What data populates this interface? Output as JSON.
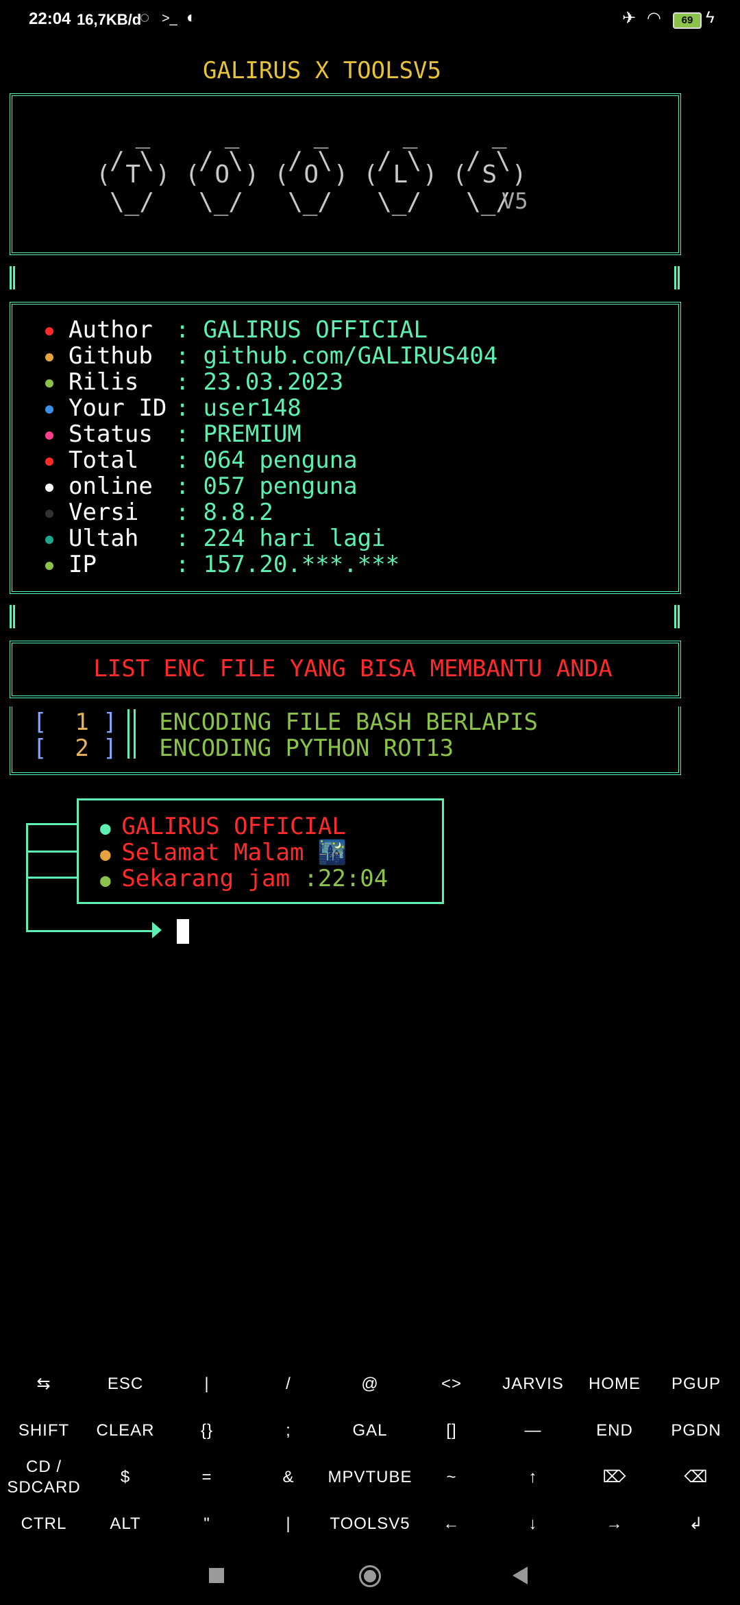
{
  "status_bar": {
    "time": "22:04",
    "speed": "16,7KB/d",
    "battery": "69",
    "icons": [
      "whatsapp-icon",
      "terminal-icon",
      "compass-icon",
      "airplane-icon",
      "wifi-icon",
      "battery-icon",
      "charging-icon"
    ]
  },
  "terminal": {
    "title": "GALIRUS X TOOLSV5",
    "logo_lines": [
      " _     _     _     _     _",
      "/ \\   / \\   / \\   / \\   / \\",
      "( T ) ( O ) ( O ) ( L ) ( S )",
      "\\_/   \\_/   \\_/   \\_/   \\_/"
    ],
    "logo_version": "V5",
    "info_separator": ":",
    "info": [
      {
        "label": "Author",
        "value": "GALIRUS OFFICIAL",
        "dot_color": "#ff2a2a"
      },
      {
        "label": "Github",
        "value": "github.com/GALIRUS404",
        "dot_color": "#e6a23c"
      },
      {
        "label": "Rilis",
        "value": "23.03.2023",
        "dot_color": "#8bc34a"
      },
      {
        "label": "Your ID",
        "value": "user148",
        "dot_color": "#3b8fe6"
      },
      {
        "label": "Status",
        "value": "PREMIUM",
        "dot_color": "#ff3f8e"
      },
      {
        "label": "Total",
        "value": "064 penguna",
        "dot_color": "#ff2a2a"
      },
      {
        "label": "online",
        "value": "057 penguna",
        "dot_color": "#ffffff"
      },
      {
        "label": "Versi",
        "value": "8.8.2",
        "dot_color": "#333333"
      },
      {
        "label": "Ultah",
        "value": "224 hari lagi",
        "dot_color": "#1fa58a"
      },
      {
        "label": "IP",
        "value": "157.20.***.***",
        "dot_color": "#8bc34a"
      }
    ],
    "list_title": "LIST ENC FILE YANG BISA MEMBANTU ANDA",
    "menu": [
      {
        "number": "1",
        "text": "ENCODING FILE BASH BERLAPIS"
      },
      {
        "number": "2",
        "text": "ENCODING PYTHON ROT13"
      }
    ],
    "greetings": [
      {
        "text": "GALIRUS OFFICIAL",
        "dot_color": "#5ef0b0"
      },
      {
        "text": "Selamat Malam 🌃",
        "dot_color": "#e6a23c"
      },
      {
        "text": "Sekarang jam ",
        "time": ":22:04",
        "dot_color": "#8bc34a"
      }
    ]
  },
  "extra_keys": [
    [
      "⇆",
      "ESC",
      "|",
      "/",
      "@",
      "<>",
      "JARVIS",
      "HOME",
      "PGUP"
    ],
    [
      "SHIFT",
      "CLEAR",
      "{}",
      ";",
      "GAL",
      "[]",
      "—",
      "END",
      "PGDN"
    ],
    [
      "CD / SDCARD",
      "$",
      "=",
      "&",
      "MPVTUBE",
      "~",
      "↑",
      "⌦",
      "⌫"
    ],
    [
      "CTRL",
      "ALT",
      "\"",
      "|",
      "TOOLSV5",
      "←",
      "↓",
      "→",
      "↲"
    ]
  ]
}
